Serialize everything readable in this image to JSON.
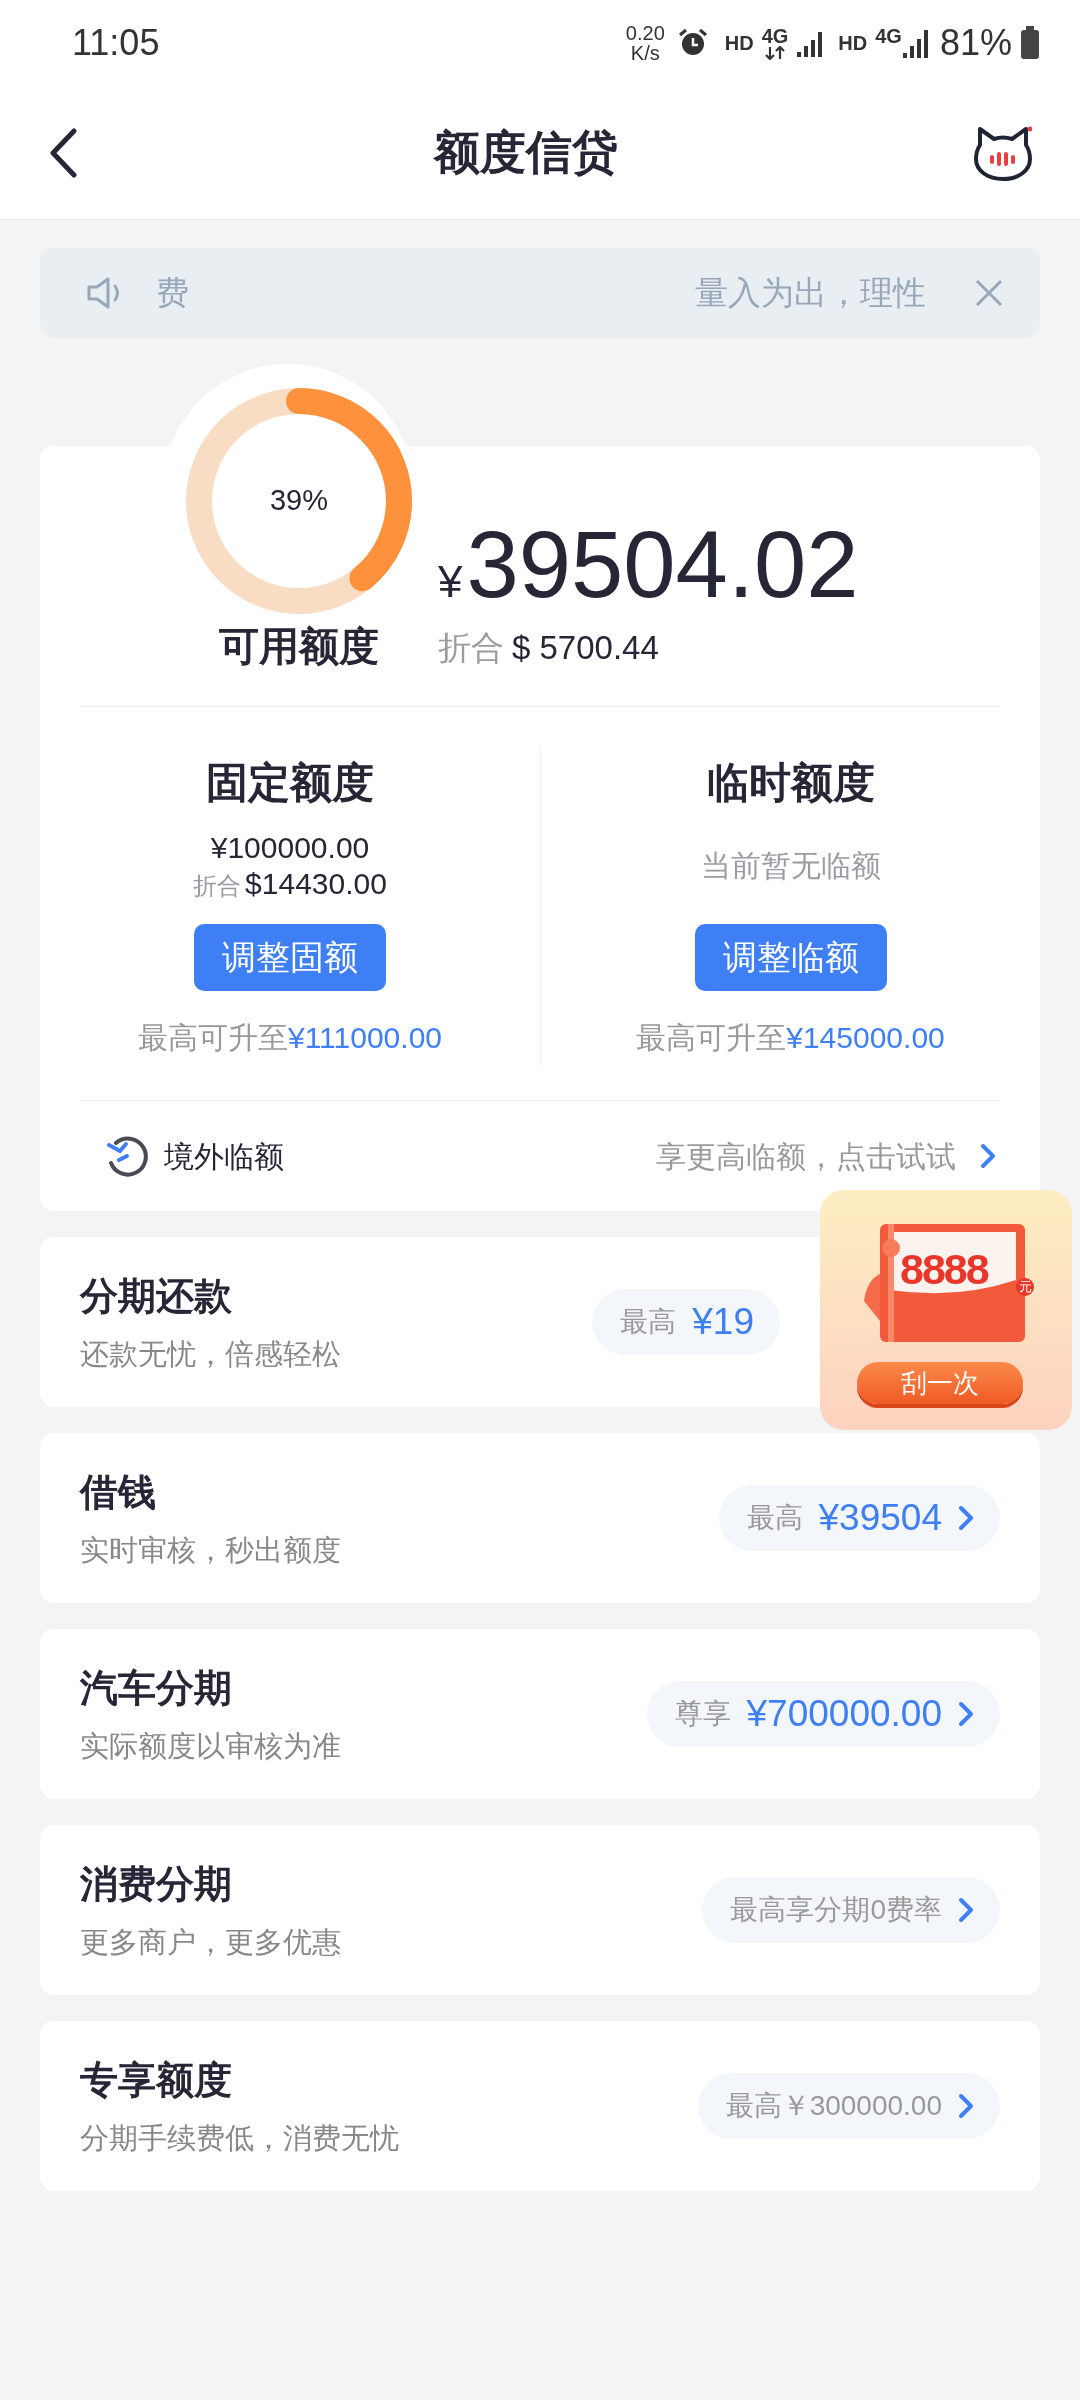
{
  "status_bar": {
    "time": "11:05",
    "net_speed": "0.20",
    "net_unit": "K/s",
    "sim1_hd": "HD",
    "sim1_net": "4G",
    "sim2_hd": "HD",
    "sim2_net": "4G",
    "battery": "81%"
  },
  "header": {
    "title": "额度信贷"
  },
  "notice": {
    "text_left": "费",
    "text_right": "量入为出，理性"
  },
  "credit": {
    "level": 0.39,
    "percent": "39%",
    "label": "可用额度",
    "currency": "¥",
    "amount": "39504.02",
    "converted_label": "折合",
    "converted_amount": "$ 5700.44"
  },
  "quotas": [
    {
      "title": "固定额度",
      "amount": "¥100000.00",
      "converted_label": "折合",
      "converted_amount": "$14430.00",
      "button": "调整固额",
      "max_label": "最高可升至",
      "max_amount": "¥111000.00"
    },
    {
      "title": "临时额度",
      "note": "当前暂无临额",
      "button": "调整临额",
      "max_label": "最高可升至",
      "max_amount": "¥145000.00"
    }
  ],
  "overseas": {
    "label": "境外临额",
    "action": "享更高临额，点击试试"
  },
  "products": [
    {
      "title": "分期还款",
      "subtitle": "还款无忧，倍感轻松",
      "kind": "amount_cut",
      "pill_label": "最高",
      "pill_value": "¥19"
    },
    {
      "title": "借钱",
      "subtitle": "实时审核，秒出额度",
      "kind": "amount",
      "pill_label": "最高",
      "pill_value": "¥39504"
    },
    {
      "title": "汽车分期",
      "subtitle": "实际额度以审核为准",
      "kind": "amount",
      "pill_label": "尊享",
      "pill_value": "¥700000.00"
    },
    {
      "title": "消费分期",
      "subtitle": "更多商户，更多优惠",
      "kind": "text",
      "pill_text": "最高享分期0费率"
    },
    {
      "title": "专享额度",
      "subtitle": "分期手续费低，消费无忧",
      "kind": "text",
      "pill_text": "最高￥300000.00"
    }
  ],
  "promo": {
    "amount": "8888",
    "unit": "元",
    "button": "刮一次"
  }
}
